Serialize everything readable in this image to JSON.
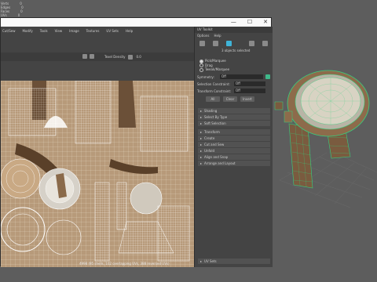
{
  "hud": {
    "rows": [
      {
        "label": "Verts",
        "value": "0"
      },
      {
        "label": "Edges",
        "value": "0"
      },
      {
        "label": "Faces",
        "value": "0"
      },
      {
        "label": "UVs",
        "value": "0"
      }
    ]
  },
  "window": {
    "controls": {
      "minimize": "—",
      "maximize": "☐",
      "close": "✕"
    }
  },
  "menu": [
    "Cut/Sew",
    "Modify",
    "Tools",
    "View",
    "Image",
    "Textures",
    "UV Sets",
    "Help"
  ],
  "toolbar": {
    "mode_label": "Texel Density",
    "percent": "0.0"
  },
  "status_line": "4998 (95 shells, 102 overlapping UVs, 388 reversed UVs)",
  "toolkit": {
    "title": "UV Toolkit",
    "menu": [
      "Options",
      "Help"
    ],
    "selection_summary": "3 objects selected",
    "pick_options": [
      "Pick/Marquee",
      "Drag",
      "Tweak/Marquee"
    ],
    "symmetry_label": "Symmetry:",
    "symmetry_value": "Off",
    "selection_constraint_label": "Selection Constraint:",
    "selection_constraint_value": "Off",
    "transform_constraint_label": "Transform Constraint:",
    "transform_constraint_value": "Off",
    "buttons": [
      "All",
      "Clear",
      "Invert"
    ],
    "sections_a": [
      "Shading",
      "Select By Type",
      "Soft Selection"
    ],
    "sections_b": [
      "Transform",
      "Create",
      "Cut and Sew",
      "Unfold",
      "Align and Snap",
      "Arrange and Layout"
    ],
    "footer": "UV Sets"
  },
  "colors": {
    "uv_bg": "#b79a7a",
    "wire_green": "#3fe08a",
    "viewport_bg": "#5d5d5d"
  }
}
